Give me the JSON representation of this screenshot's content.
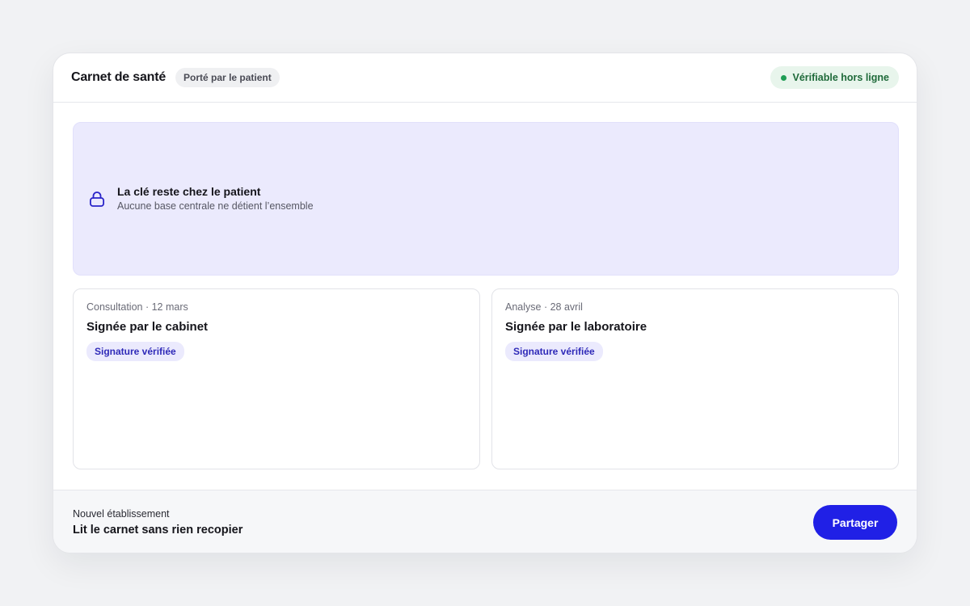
{
  "header": {
    "title": "Carnet de santé",
    "carried_pill": "Porté par le patient",
    "status_badge": "Vérifiable hors ligne"
  },
  "banner": {
    "icon": "lock-icon",
    "title": "La clé reste chez le patient",
    "subtitle": "Aucune base centrale ne détient l’ensemble"
  },
  "records": [
    {
      "meta": "Consultation · 12 mars",
      "title": "Signée par le cabinet",
      "badge": "Signature vérifiée"
    },
    {
      "meta": "Analyse · 28 avril",
      "title": "Signée par le laboratoire",
      "badge": "Signature vérifiée"
    }
  ],
  "footer": {
    "label": "Nouvel établissement",
    "title": "Lit le carnet sans rien recopier",
    "share_label": "Partager"
  },
  "colors": {
    "accent": "#2020e6",
    "banner_bg": "#ebeafd",
    "status_green": "#1f9d55"
  }
}
